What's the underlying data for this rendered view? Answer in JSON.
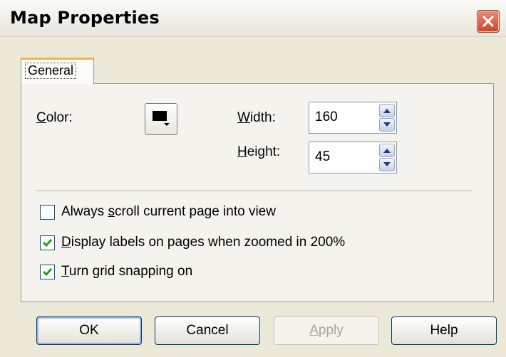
{
  "window": {
    "title": "Map Properties"
  },
  "tabs": [
    {
      "label": "General",
      "selected": true
    }
  ],
  "general": {
    "color_label": "Color:",
    "color_value": "#000000",
    "width_label": "Width:",
    "width_value": "160",
    "height_label": "Height:",
    "height_value": "45"
  },
  "options": [
    {
      "label": "Always scroll current page into view",
      "checked": false
    },
    {
      "label": "Display labels on pages when zoomed in 200%",
      "checked": true
    },
    {
      "label": "Turn grid snapping on",
      "checked": true
    }
  ],
  "buttons": {
    "ok": "OK",
    "cancel": "Cancel",
    "apply": "Apply",
    "help": "Help"
  }
}
